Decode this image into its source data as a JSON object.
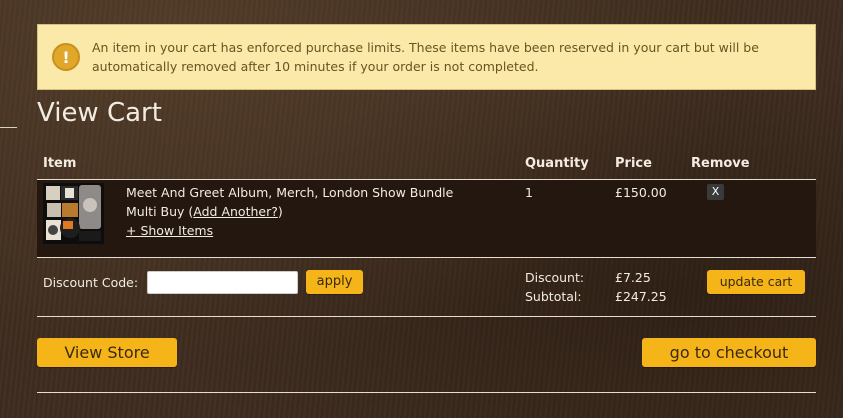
{
  "alert": {
    "icon": "warning-icon",
    "message": "An item in your cart has enforced purchase limits. These items have been reserved in your cart but will be automatically removed after 10 minutes if your order is not completed."
  },
  "page": {
    "title": "View Cart"
  },
  "table": {
    "headers": {
      "item": "Item",
      "quantity": "Quantity",
      "price": "Price",
      "remove": "Remove"
    },
    "rows": [
      {
        "name_line1": "Meet And Greet Album, Merch, London Show Bundle",
        "name_line2_prefix": "Multi Buy (",
        "add_another": "Add Another?",
        "name_line2_suffix": ")",
        "show_items": "+ Show Items",
        "quantity": "1",
        "price": "£150.00",
        "remove_label": "X"
      }
    ]
  },
  "discount": {
    "label": "Discount Code:",
    "placeholder": "",
    "apply_label": "apply",
    "discount_label": "Discount:",
    "discount_value": "£7.25",
    "subtotal_label": "Subtotal:",
    "subtotal_value": "£247.25",
    "update_label": "update cart"
  },
  "actions": {
    "view_store": "View Store",
    "checkout": "go to checkout"
  },
  "colors": {
    "accent": "#f5b417",
    "alert_bg": "#fbe9a9",
    "alert_text": "#6b5220",
    "row_bg": "#23170f"
  }
}
